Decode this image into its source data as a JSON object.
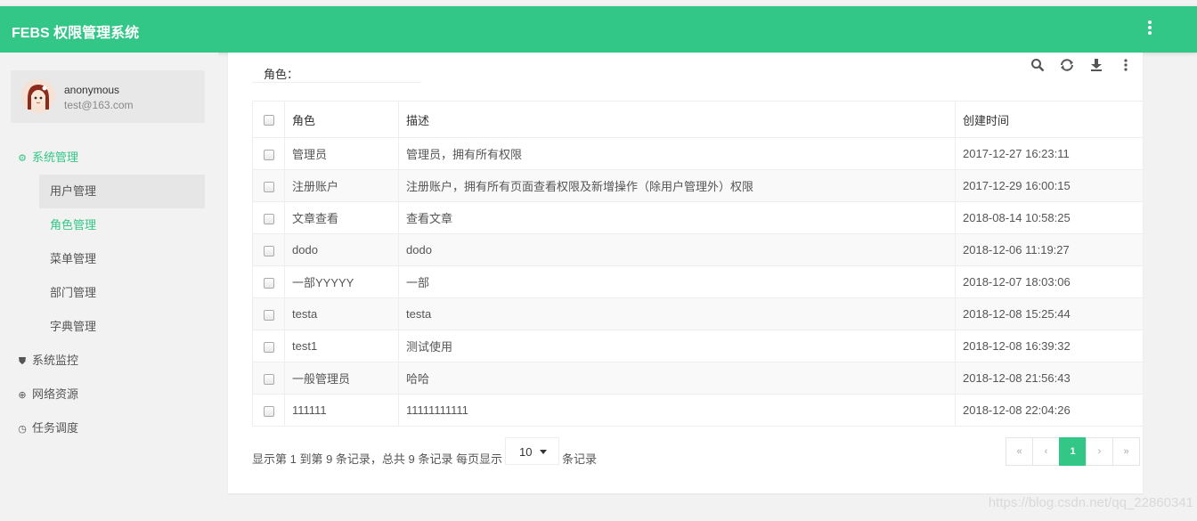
{
  "header": {
    "brand": "FEBS 权限管理系统"
  },
  "user": {
    "name": "anonymous",
    "email": "test@163.com"
  },
  "nav": {
    "system": {
      "label": "系统管理",
      "icon": "gear-icon"
    },
    "sub": [
      "用户管理",
      "角色管理",
      "菜单管理",
      "部门管理",
      "字典管理"
    ],
    "others": [
      {
        "label": "系统监控",
        "icon": "shield-icon"
      },
      {
        "label": "网络资源",
        "icon": "globe-icon"
      },
      {
        "label": "任务调度",
        "icon": "clock-icon"
      }
    ]
  },
  "filter": {
    "label": "角色：",
    "value": ""
  },
  "table": {
    "headers": [
      "角色",
      "描述",
      "创建时间"
    ],
    "rows": [
      [
        "管理员",
        "管理员，拥有所有权限",
        "2017-12-27 16:23:11"
      ],
      [
        "注册账户",
        "注册账户，拥有所有页面查看权限及新增操作（除用户管理外）权限",
        "2017-12-29 16:00:15"
      ],
      [
        "文章查看",
        "查看文章",
        "2018-08-14 10:58:25"
      ],
      [
        "dodo",
        "dodo",
        "2018-12-06 11:19:27"
      ],
      [
        "一部YYYYY",
        "一部",
        "2018-12-07 18:03:06"
      ],
      [
        "testa",
        "testa",
        "2018-12-08 15:25:44"
      ],
      [
        "test1",
        "测试使用",
        "2018-12-08 16:39:32"
      ],
      [
        "一般管理员",
        "哈哈",
        "2018-12-08 21:56:43"
      ],
      [
        "111111",
        "11111111111",
        "2018-12-08 22:04:26"
      ]
    ]
  },
  "footer": {
    "info": "显示第 1 到第 9 条记录，总共 9 条记录 每页显示",
    "page_size": "10",
    "suffix": "条记录"
  },
  "pager": {
    "first": "«",
    "prev": "‹",
    "current": "1",
    "next": "›",
    "last": "»"
  },
  "watermark": "https://blog.csdn.net/qq_22860341"
}
